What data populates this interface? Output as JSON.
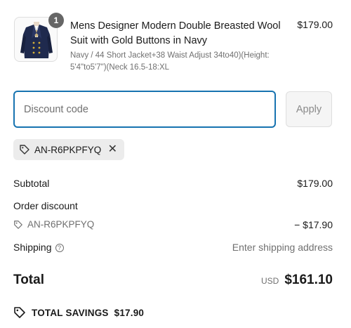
{
  "product": {
    "quantity": "1",
    "title": "Mens Designer Modern Double Breasted Wool Suit with Gold Buttons in Navy",
    "variant": "Navy / 44 Short Jacket+38 Waist Adjust 34to40)(Height: 5'4\"to5'7\")(Neck 16.5-18:XL",
    "price": "$179.00"
  },
  "discount": {
    "placeholder": "Discount code",
    "apply_label": "Apply",
    "applied_code": "AN-R6PKPFYQ"
  },
  "summary": {
    "subtotal_label": "Subtotal",
    "subtotal_value": "$179.00",
    "order_discount_label": "Order discount",
    "order_discount_code": "AN-R6PKPFYQ",
    "order_discount_value": "− $17.90",
    "shipping_label": "Shipping",
    "shipping_value": "Enter shipping address",
    "total_label": "Total",
    "total_currency": "USD",
    "total_value": "$161.10",
    "savings_label": "TOTAL SAVINGS",
    "savings_value": "$17.90"
  },
  "colors": {
    "accent": "#1773b0",
    "muted": "#707070",
    "badge": "#666666",
    "suit": "#1f2a4e"
  }
}
